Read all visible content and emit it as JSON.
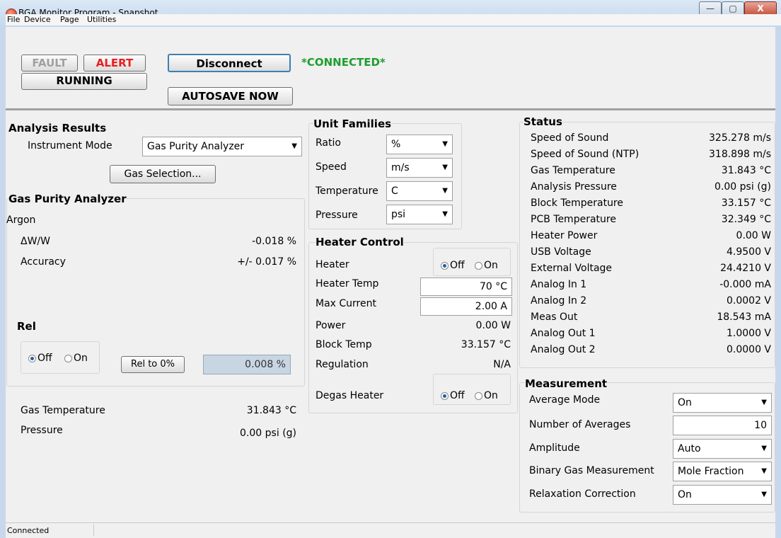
{
  "window": {
    "title": "BGA Monitor Program - Snapshot",
    "min": "—",
    "max": "▢",
    "close": "X"
  },
  "menu": [
    "File",
    "Device",
    "Page",
    "Utilities"
  ],
  "toolbar": {
    "fault": "FAULT",
    "alert": "ALERT",
    "running": "RUNNING",
    "disconnect": "Disconnect",
    "autosave": "AUTOSAVE NOW",
    "connected": "*CONNECTED*"
  },
  "analysis": {
    "heading": "Analysis Results",
    "mode_label": "Instrument Mode",
    "mode_value": "Gas Purity Analyzer",
    "gas_selection": "Gas Selection...",
    "gpa_heading": "Gas Purity Analyzer",
    "gas": "Argon",
    "dw_label": "ΔW/W",
    "dw_value": "-0.018 %",
    "acc_label": "Accuracy",
    "acc_value": "+/- 0.017 %",
    "rel_heading": "Rel",
    "rel_off": "Off",
    "rel_on": "On",
    "rel_btn": "Rel to 0%",
    "rel_value": "0.008 %",
    "gastemp_label": "Gas Temperature",
    "gastemp_value": "31.843 °C",
    "pressure_label": "Pressure",
    "pressure_value": "0.00 psi (g)"
  },
  "units": {
    "heading": "Unit Families",
    "rows": [
      {
        "label": "Ratio",
        "value": "%"
      },
      {
        "label": "Speed",
        "value": "m/s"
      },
      {
        "label": "Temperature",
        "value": "C"
      },
      {
        "label": "Pressure",
        "value": "psi"
      }
    ]
  },
  "heater": {
    "heading": "Heater Control",
    "heater_label": "Heater",
    "off": "Off",
    "on": "On",
    "temp_label": "Heater Temp",
    "temp_value": "70 °C",
    "current_label": "Max Current",
    "current_value": "2.00 A",
    "power_label": "Power",
    "power_value": "0.00 W",
    "block_label": "Block Temp",
    "block_value": "33.157 °C",
    "reg_label": "Regulation",
    "reg_value": "N/A",
    "degas_label": "Degas Heater"
  },
  "status": {
    "heading": "Status",
    "rows": [
      {
        "label": "Speed of Sound",
        "value": "325.278 m/s"
      },
      {
        "label": "Speed of Sound (NTP)",
        "value": "318.898 m/s"
      },
      {
        "label": "Gas Temperature",
        "value": "31.843 °C"
      },
      {
        "label": "Analysis Pressure",
        "value": "0.00 psi (g)"
      },
      {
        "label": "Block Temperature",
        "value": "33.157 °C"
      },
      {
        "label": "PCB Temperature",
        "value": "32.349 °C"
      },
      {
        "label": "Heater Power",
        "value": "0.00 W"
      },
      {
        "label": "USB Voltage",
        "value": "4.9500 V"
      },
      {
        "label": "External Voltage",
        "value": "24.4210 V"
      },
      {
        "label": "Analog In 1",
        "value": "-0.000 mA"
      },
      {
        "label": "Analog In 2",
        "value": "0.0002 V"
      },
      {
        "label": "Meas Out",
        "value": "18.543 mA"
      },
      {
        "label": "Analog Out 1",
        "value": "1.0000 V"
      },
      {
        "label": "Analog Out 2",
        "value": "0.0000 V"
      }
    ]
  },
  "measurement": {
    "heading": "Measurement",
    "avg_mode_label": "Average Mode",
    "avg_mode_value": "On",
    "num_avg_label": "Number of Averages",
    "num_avg_value": "10",
    "amp_label": "Amplitude",
    "amp_value": "Auto",
    "binary_label": "Binary Gas Measurement",
    "binary_value": "Mole Fraction",
    "relax_label": "Relaxation Correction",
    "relax_value": "On"
  },
  "statusbar": {
    "text": "Connected"
  }
}
